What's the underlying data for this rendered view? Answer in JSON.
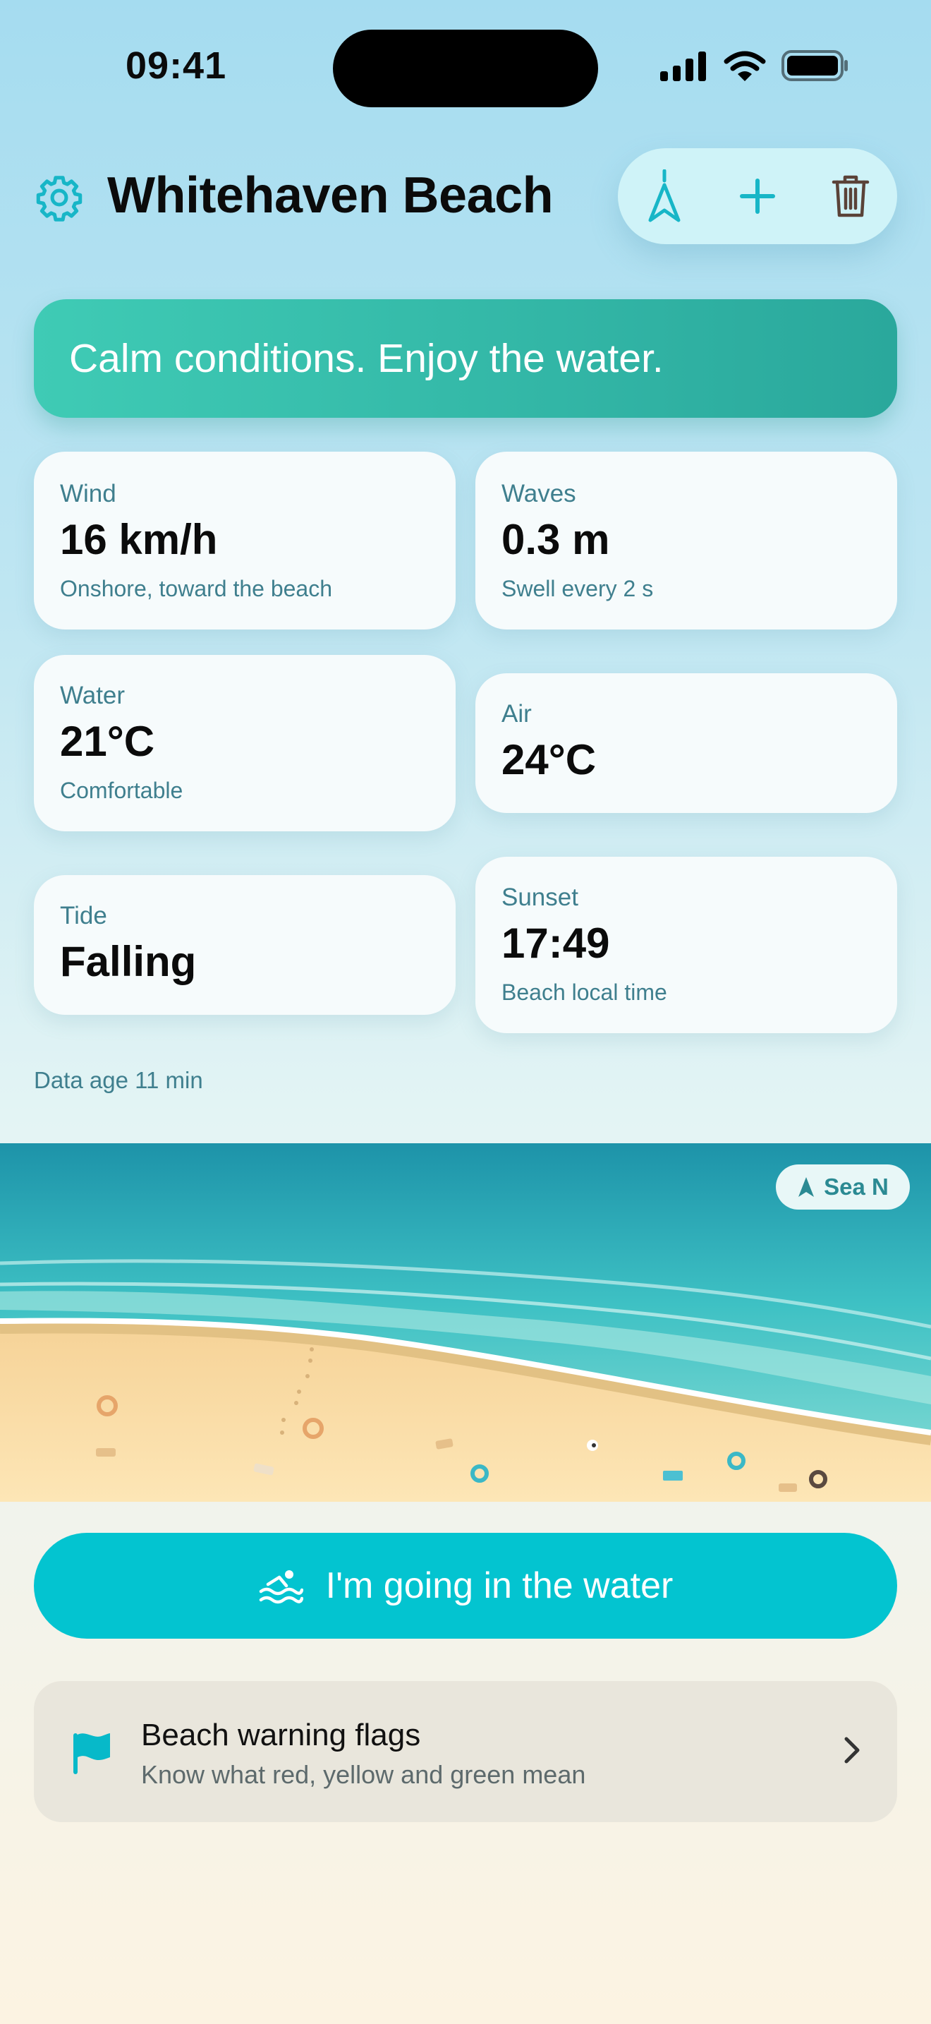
{
  "status_bar": {
    "time": "09:41"
  },
  "header": {
    "title": "Whitehaven Beach",
    "icons": {
      "settings": "gear-icon",
      "navigate": "navigation-arrow-icon",
      "add": "plus-icon",
      "delete": "trash-icon"
    }
  },
  "banner": {
    "text": "Calm conditions. Enjoy the water."
  },
  "cards": {
    "wind": {
      "label": "Wind",
      "value": "16 km/h",
      "sub": "Onshore, toward the beach"
    },
    "waves": {
      "label": "Waves",
      "value": "0.3 m",
      "sub": "Swell every 2 s"
    },
    "water": {
      "label": "Water",
      "value": "21°C",
      "sub": "Comfortable"
    },
    "air": {
      "label": "Air",
      "value": "24°C"
    },
    "tide": {
      "label": "Tide",
      "value": "Falling"
    },
    "sunset": {
      "label": "Sunset",
      "value": "17:49",
      "sub": "Beach local time"
    }
  },
  "data_age": "Data age 11 min",
  "scene": {
    "sea_direction_label": "Sea N"
  },
  "cta": {
    "label": "I'm going in the water",
    "icon": "swimmer-icon"
  },
  "flags": {
    "title": "Beach warning flags",
    "subtitle": "Know what red, yellow and green mean",
    "icon": "flag-icon"
  },
  "colors": {
    "accent": "#03c4d0",
    "banner": "#2fb7a8",
    "muted_text": "#3f7f8e"
  }
}
